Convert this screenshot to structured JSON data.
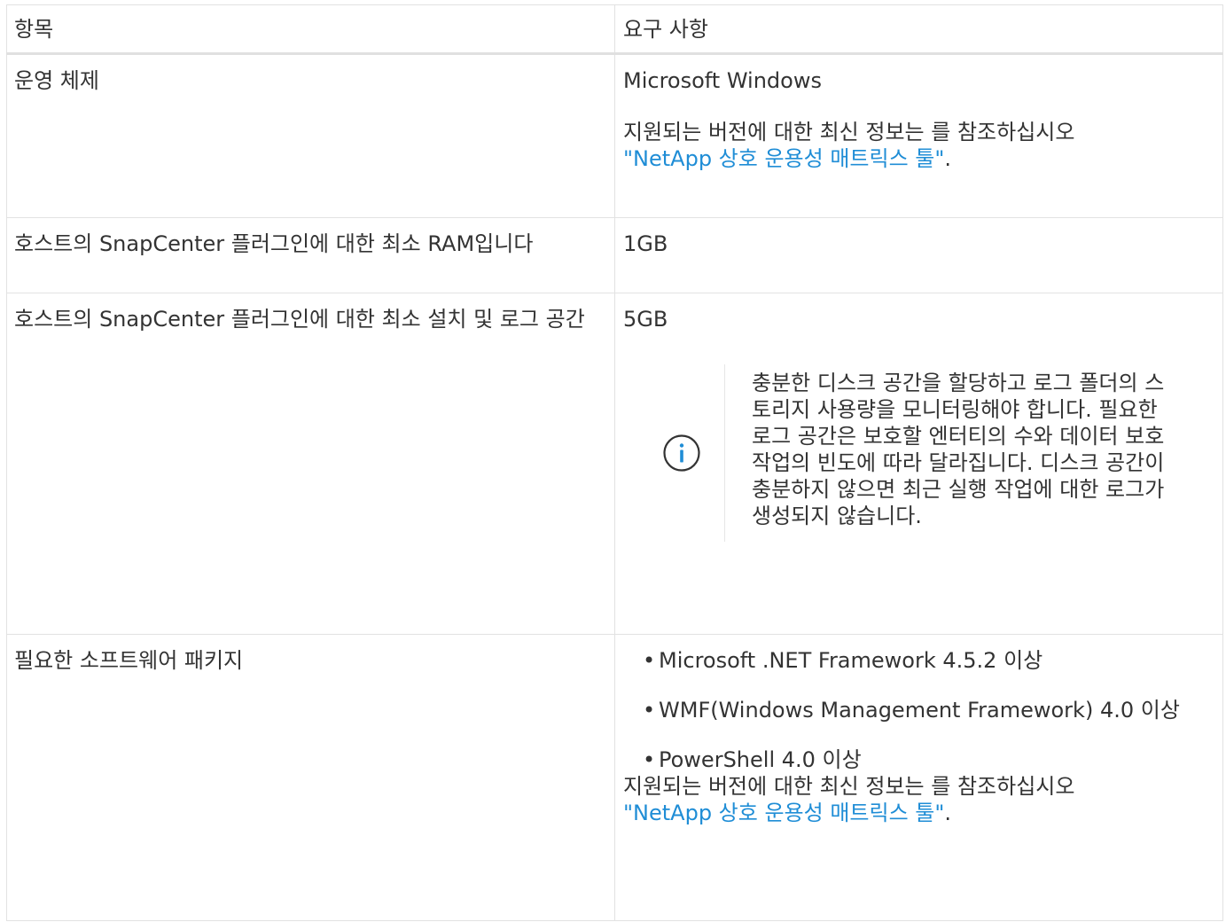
{
  "table": {
    "headers": {
      "item": "항목",
      "requirement": "요구 사항"
    },
    "rows": {
      "os": {
        "item": "운영 체제",
        "value": "Microsoft Windows",
        "info_prefix": "지원되는 버전에 대한 최신 정보는 를 참조하십시오",
        "link": "\"NetApp 상호 운용성 매트릭스 툴\"",
        "suffix": "."
      },
      "ram": {
        "item": "호스트의 SnapCenter 플러그인에 대한 최소 RAM입니다",
        "value": "1GB"
      },
      "space": {
        "item": "호스트의 SnapCenter 플러그인에 대한 최소 설치 및 로그 공간",
        "value": "5GB",
        "note_icon": "info-circle-icon",
        "note": "충분한 디스크 공간을 할당하고 로그 폴더의 스토리지 사용량을 모니터링해야 합니다. 필요한 로그 공간은 보호할 엔터티의 수와 데이터 보호 작업의 빈도에 따라 달라집니다. 디스크 공간이 충분하지 않으면 최근 실행 작업에 대한 로그가 생성되지 않습니다."
      },
      "software": {
        "item": "필요한 소프트웨어 패키지",
        "packages": [
          "Microsoft .NET Framework 4.5.2 이상",
          "WMF(Windows Management Framework) 4.0 이상",
          "PowerShell 4.0 이상"
        ],
        "bullet": "•",
        "info_prefix": "지원되는 버전에 대한 최신 정보는 를 참조하십시오",
        "link": "\"NetApp 상호 운용성 매트릭스 툴\"",
        "suffix": "."
      }
    }
  },
  "colors": {
    "text": "#333333",
    "link": "#1f8dd6",
    "border": "#e2e2e2",
    "icon": "#1f8dd6"
  }
}
